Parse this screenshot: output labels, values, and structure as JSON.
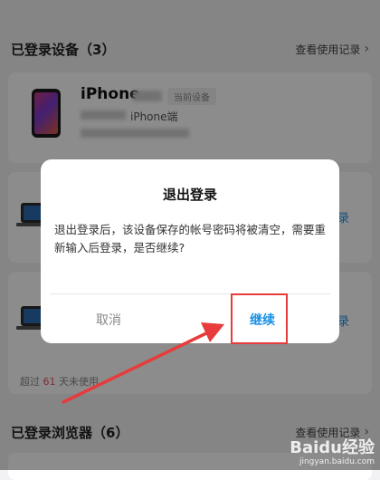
{
  "devices_section": {
    "title": "已登录设备（3）",
    "link": "查看使用记录"
  },
  "current_device": {
    "name": "iPhone",
    "badge": "当前设备",
    "sub": "iPhone端"
  },
  "other_devices": {
    "fragment_label": "录",
    "usage_prefix": "超过 ",
    "usage_days": "61",
    "usage_suffix": " 天未使用"
  },
  "browsers_section": {
    "title": "已登录浏览器（6）",
    "link": "查看使用记录"
  },
  "dialog": {
    "title": "退出登录",
    "message": "退出登录后，该设备保存的帐号密码将被清空，需要重新输入后登录，是否继续?",
    "cancel": "取消",
    "continue": "继续"
  },
  "watermark": {
    "logo": "Baidu经验",
    "url": "jingyan.baidu.com"
  },
  "colors": {
    "accent": "#1a90e6",
    "highlight": "#e83b3b",
    "warning_number": "#e55050"
  }
}
